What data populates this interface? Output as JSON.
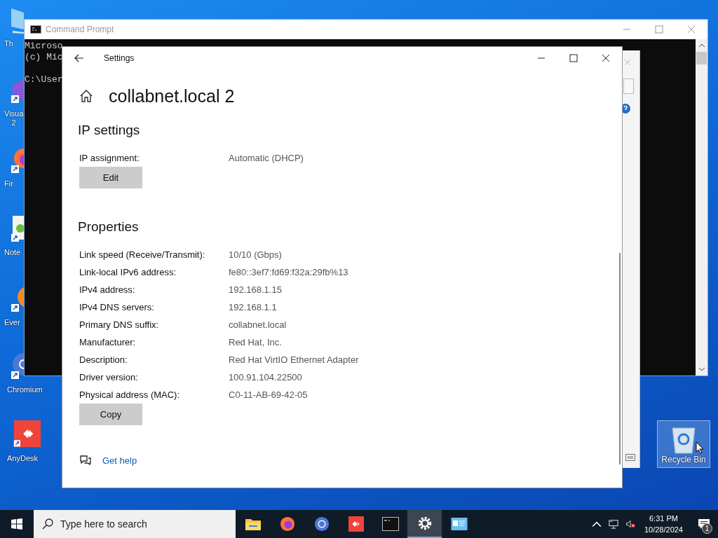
{
  "desktop_icons": [
    {
      "kind": "pc",
      "label": "Th"
    },
    {
      "kind": "vs",
      "label": "Visua\n2"
    },
    {
      "kind": "firefox",
      "label": "Fir"
    },
    {
      "kind": "notepad",
      "label": "Note"
    },
    {
      "kind": "everything",
      "label": "Ever"
    },
    {
      "kind": "chromium",
      "label": "Chromium"
    },
    {
      "kind": "anydesk",
      "label": "AnyDesk"
    }
  ],
  "recycle_bin": {
    "label": "Recycle Bin",
    "selected": true
  },
  "command_prompt": {
    "title": "Command Prompt",
    "lines": [
      "Microso",
      "(c) Mic",
      "C:\\User"
    ]
  },
  "settings": {
    "title": "Settings",
    "heading": "collabnet.local 2",
    "ip_settings": {
      "title": "IP settings",
      "rows": [
        {
          "label": "IP assignment:",
          "value": "Automatic (DHCP)"
        }
      ],
      "button": "Edit"
    },
    "properties": {
      "title": "Properties",
      "rows": [
        {
          "label": "Link speed (Receive/Transmit):",
          "value": "10/10 (Gbps)"
        },
        {
          "label": "Link-local IPv6 address:",
          "value": "fe80::3ef7:fd69:f32a:29fb%13"
        },
        {
          "label": "IPv4 address:",
          "value": "192.168.1.15"
        },
        {
          "label": "IPv4 DNS servers:",
          "value": "192.168.1.1"
        },
        {
          "label": "Primary DNS suffix:",
          "value": "collabnet.local"
        },
        {
          "label": "Manufacturer:",
          "value": "Red Hat, Inc."
        },
        {
          "label": "Description:",
          "value": "Red Hat VirtIO Ethernet Adapter"
        },
        {
          "label": "Driver version:",
          "value": "100.91.104.22500"
        },
        {
          "label": "Physical address (MAC):",
          "value": "C0-11-AB-69-42-05"
        }
      ],
      "button": "Copy"
    },
    "help_link": "Get help"
  },
  "taskbar": {
    "search": {
      "placeholder": "Type here to search"
    },
    "apps": [
      {
        "kind": "folder",
        "selected": false
      },
      {
        "kind": "firefox",
        "selected": false
      },
      {
        "kind": "chromium",
        "selected": false
      },
      {
        "kind": "anydesk",
        "selected": false
      },
      {
        "kind": "terminal",
        "selected": false
      },
      {
        "kind": "settings",
        "selected": true
      },
      {
        "kind": "control-panel",
        "selected": false
      }
    ],
    "time": "6:31 PM",
    "date": "10/28/2024",
    "notification_count": "1"
  }
}
